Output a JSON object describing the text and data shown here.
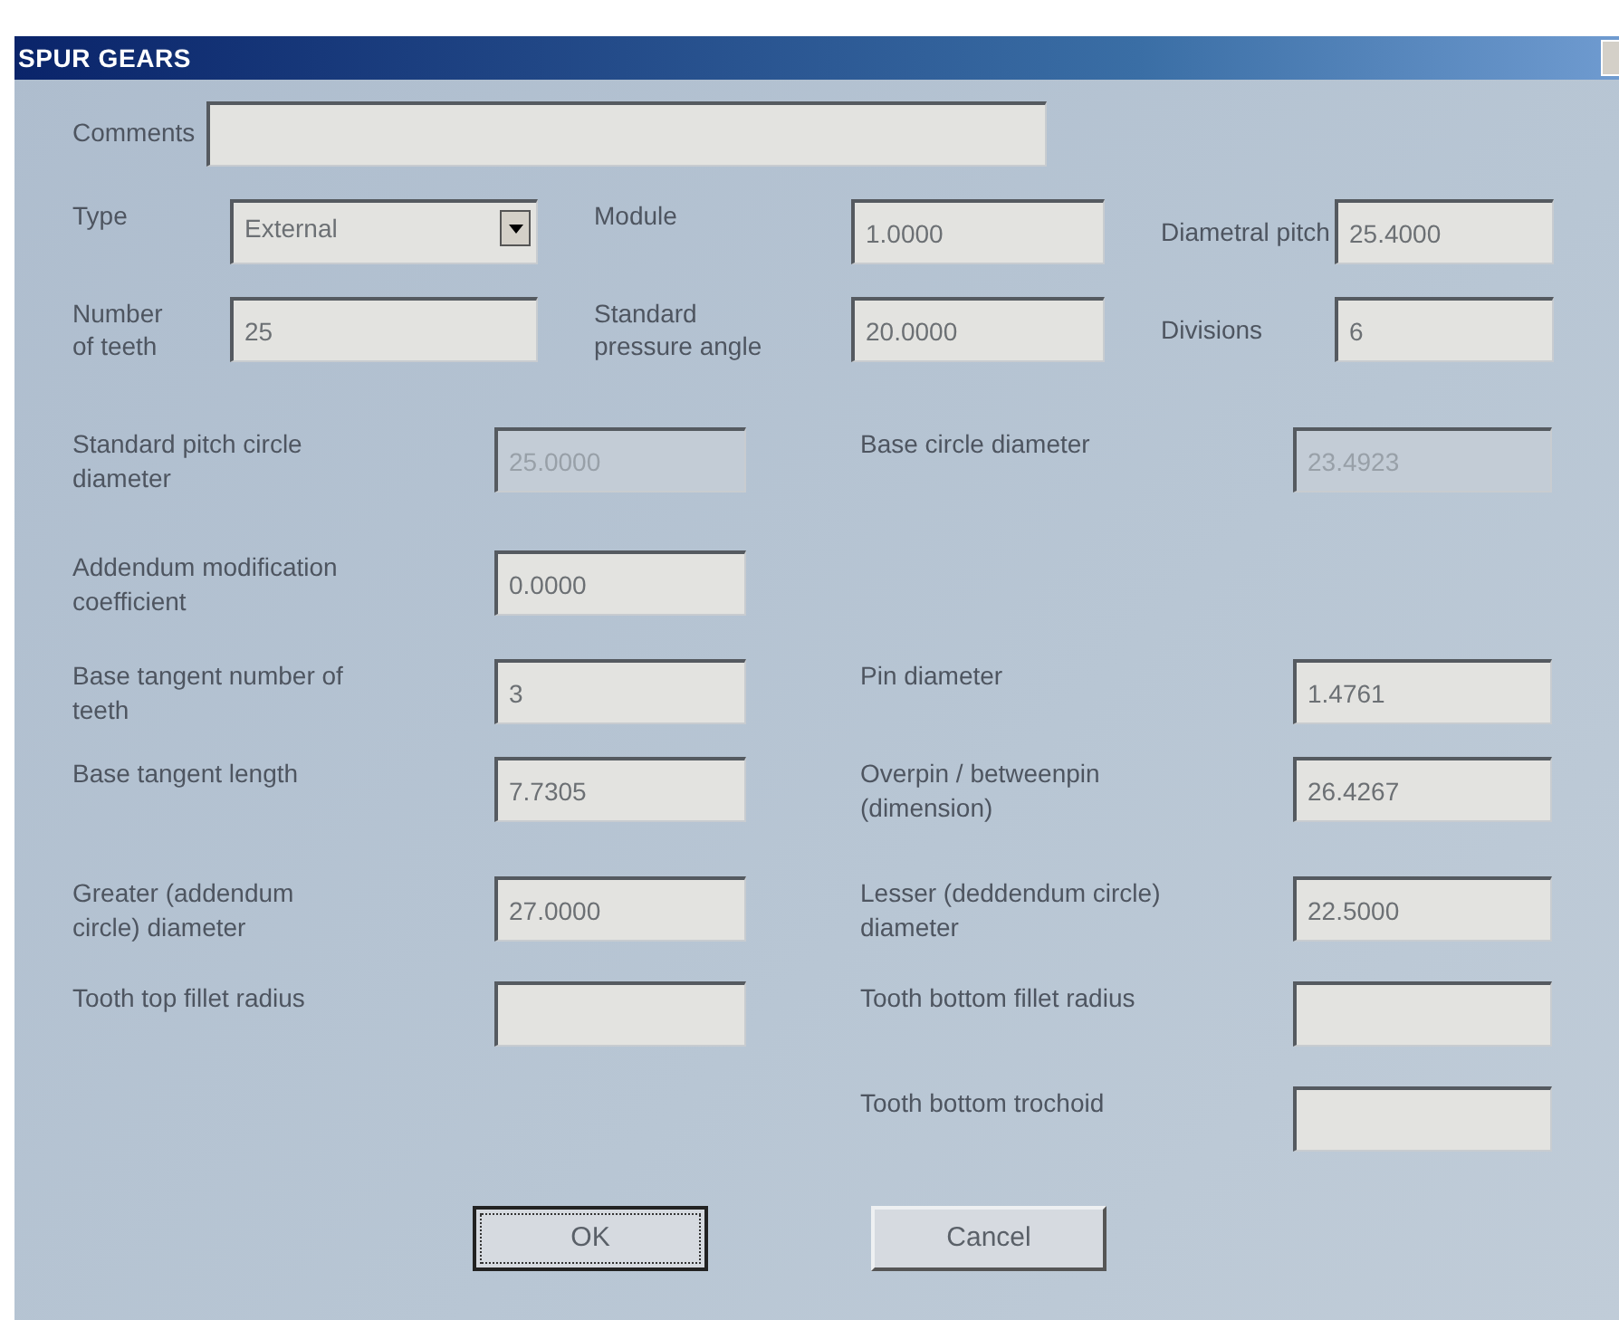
{
  "window": {
    "title": "SPUR GEARS"
  },
  "comments": {
    "label": "Comments"
  },
  "top_fields": [
    {
      "label": "Type",
      "kind": "dropdown",
      "value": "External"
    },
    {
      "label": "Module",
      "kind": "text",
      "value": "1.0000"
    },
    {
      "label": "Diametral pitch",
      "kind": "text",
      "value": "25.4000"
    },
    {
      "label": "Number of teeth",
      "kind": "text",
      "value": "25"
    },
    {
      "label": "Standard pressure angle",
      "kind": "text",
      "value": "20.0000"
    },
    {
      "label": "Divisions",
      "kind": "text",
      "value": "6"
    }
  ],
  "rows": [
    {
      "left": {
        "label": "Standard pitch circle diameter",
        "value": "25.0000",
        "disabled": true
      },
      "right": {
        "label": "Base circle diameter",
        "value": "23.4923",
        "disabled": true
      }
    },
    {
      "left": {
        "label": "Addendum modification coefficient",
        "value": "0.0000",
        "disabled": false
      }
    },
    {
      "left": {
        "label": "Base tangent number of teeth",
        "value": "3",
        "disabled": false
      },
      "right": {
        "label": "Pin diameter",
        "value": "1.4761",
        "disabled": false
      }
    },
    {
      "left": {
        "label": "Base tangent length",
        "value": "7.7305",
        "disabled": false
      },
      "right": {
        "label": "Overpin / betweenpin (dimension)",
        "value": "26.4267",
        "disabled": false
      }
    },
    {
      "left": {
        "label": "Greater (addendum circle) diameter",
        "value": "27.0000",
        "disabled": false
      },
      "right": {
        "label": "Lesser (deddendum circle) diameter",
        "value": "22.5000",
        "disabled": false
      }
    },
    {
      "left": {
        "label": "Tooth top fillet radius",
        "disabled": false
      },
      "right": {
        "label": "Tooth bottom fillet radius",
        "disabled": false
      }
    },
    {
      "right": {
        "label": "Tooth bottom trochoid",
        "disabled": false
      }
    }
  ],
  "buttons": [
    {
      "label": "OK",
      "focused": true
    },
    {
      "label": "Cancel",
      "focused": false
    }
  ]
}
